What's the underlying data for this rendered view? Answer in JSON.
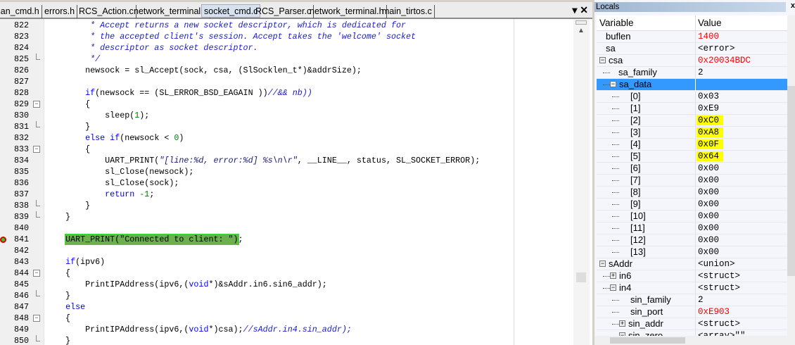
{
  "tabs": [
    "wlan_cmd.h",
    "errors.h",
    "RCS_Action.c",
    "network_terminal.c",
    "socket_cmd.c",
    "RCS_Parser.c",
    "network_terminal.h",
    "main_tirtos.c"
  ],
  "active_tab": "socket_cmd.c",
  "tab_controls": "▾ ✕",
  "code": [
    {
      "n": "822",
      "t": [
        [
          "cm",
          "         * Accept returns a new socket descriptor, which is dedicated for"
        ]
      ]
    },
    {
      "n": "823",
      "t": [
        [
          "cm",
          "         * the accepted client's session. Accept takes the 'welcome' socket"
        ]
      ]
    },
    {
      "n": "824",
      "t": [
        [
          "cm",
          "         * descriptor as socket descriptor."
        ]
      ]
    },
    {
      "n": "825",
      "f": "end",
      "t": [
        [
          "cm",
          "         */"
        ]
      ]
    },
    {
      "n": "826",
      "t": [
        [
          "",
          "        newsock = sl_Accept(sock, csa, (SlSocklen_t*)&addrSize);"
        ]
      ]
    },
    {
      "n": "827",
      "t": []
    },
    {
      "n": "828",
      "t": [
        [
          "",
          "        "
        ],
        [
          "kw",
          "if"
        ],
        [
          "",
          "(newsock == (SL_ERROR_BSD_EAGAIN ))"
        ],
        [
          "cm",
          "//&& nb))"
        ]
      ]
    },
    {
      "n": "829",
      "f": "open",
      "t": [
        [
          "",
          "        {"
        ]
      ]
    },
    {
      "n": "830",
      "t": [
        [
          "",
          "            sleep("
        ],
        [
          "nm",
          "1"
        ],
        [
          "",
          ");"
        ]
      ]
    },
    {
      "n": "831",
      "f": "end",
      "t": [
        [
          "",
          "        }"
        ]
      ]
    },
    {
      "n": "832",
      "t": [
        [
          "",
          "        "
        ],
        [
          "kw",
          "else if"
        ],
        [
          "",
          "(newsock < "
        ],
        [
          "nm",
          "0"
        ],
        [
          "",
          ")"
        ]
      ]
    },
    {
      "n": "833",
      "f": "open",
      "t": [
        [
          "",
          "        {"
        ]
      ]
    },
    {
      "n": "834",
      "t": [
        [
          "",
          "            UART_PRINT("
        ],
        [
          "str",
          "\"[line:%d, error:%d] %s\\n\\r\""
        ],
        [
          "",
          ", __LINE__, status, SL_SOCKET_ERROR);"
        ]
      ]
    },
    {
      "n": "835",
      "t": [
        [
          "",
          "            sl_Close(newsock);"
        ]
      ]
    },
    {
      "n": "836",
      "t": [
        [
          "",
          "            sl_Close(sock);"
        ]
      ]
    },
    {
      "n": "837",
      "t": [
        [
          "",
          "            "
        ],
        [
          "kw",
          "return"
        ],
        [
          "nm",
          " -1"
        ],
        [
          "",
          ";"
        ]
      ]
    },
    {
      "n": "838",
      "f": "end",
      "t": [
        [
          "",
          "        }"
        ]
      ]
    },
    {
      "n": "839",
      "f": "end",
      "t": [
        [
          "",
          "    }"
        ]
      ]
    },
    {
      "n": "840",
      "t": []
    },
    {
      "n": "841",
      "cur": true,
      "t": [
        [
          "",
          "    "
        ],
        [
          "hl",
          "UART_PRINT(\"Connected to client: \")"
        ],
        [
          "",
          ";"
        ]
      ]
    },
    {
      "n": "842",
      "t": []
    },
    {
      "n": "843",
      "t": [
        [
          "",
          "    "
        ],
        [
          "kw",
          "if"
        ],
        [
          "",
          "(ipv6)"
        ]
      ]
    },
    {
      "n": "844",
      "f": "open",
      "t": [
        [
          "",
          "    {"
        ]
      ]
    },
    {
      "n": "845",
      "t": [
        [
          "",
          "        PrintIPAddress(ipv6,("
        ],
        [
          "kw",
          "void"
        ],
        [
          "",
          "*)&sAddr.in6.sin6_addr);"
        ]
      ]
    },
    {
      "n": "846",
      "f": "end",
      "t": [
        [
          "",
          "    }"
        ]
      ]
    },
    {
      "n": "847",
      "t": [
        [
          "",
          "    "
        ],
        [
          "kw",
          "else"
        ]
      ]
    },
    {
      "n": "848",
      "f": "open",
      "t": [
        [
          "",
          "    {"
        ]
      ]
    },
    {
      "n": "849",
      "t": [
        [
          "",
          "        PrintIPAddress(ipv6,("
        ],
        [
          "kw",
          "void"
        ],
        [
          "",
          "*)csa);"
        ],
        [
          "cm",
          "//sAddr.in4.sin_addr);"
        ]
      ]
    },
    {
      "n": "850",
      "f": "end",
      "t": [
        [
          "",
          "    }"
        ]
      ]
    }
  ],
  "locals": {
    "title": "Locals",
    "col_variable": "Variable",
    "col_value": "Value",
    "rows": [
      {
        "name": "buflen",
        "value": "1400",
        "changed": true,
        "d": 0
      },
      {
        "name": "sa",
        "value": "<error>",
        "d": 0
      },
      {
        "name": "csa",
        "value": "0x20034BDC",
        "changed": true,
        "d": 0,
        "exp": "-"
      },
      {
        "name": "sa_family",
        "value": "2",
        "d": 1
      },
      {
        "name": "sa_data",
        "value": "",
        "d": 1,
        "exp": "-",
        "sel": true
      },
      {
        "name": "[0]",
        "value": "0x03",
        "d": 2
      },
      {
        "name": "[1]",
        "value": "0xE9",
        "d": 2
      },
      {
        "name": "[2]",
        "value": "0xC0",
        "d": 2,
        "yellow": true
      },
      {
        "name": "[3]",
        "value": "0xA8",
        "d": 2,
        "yellow": true
      },
      {
        "name": "[4]",
        "value": "0x0F",
        "d": 2,
        "yellow": true
      },
      {
        "name": "[5]",
        "value": "0x64",
        "d": 2,
        "yellow": true
      },
      {
        "name": "[6]",
        "value": "0x00",
        "d": 2
      },
      {
        "name": "[7]",
        "value": "0x00",
        "d": 2
      },
      {
        "name": "[8]",
        "value": "0x00",
        "d": 2
      },
      {
        "name": "[9]",
        "value": "0x00",
        "d": 2
      },
      {
        "name": "[10]",
        "value": "0x00",
        "d": 2
      },
      {
        "name": "[11]",
        "value": "0x00",
        "d": 2
      },
      {
        "name": "[12]",
        "value": "0x00",
        "d": 2
      },
      {
        "name": "[13]",
        "value": "0x00",
        "d": 2
      },
      {
        "name": "sAddr",
        "value": "<union>",
        "d": 0,
        "exp": "-"
      },
      {
        "name": "in6",
        "value": "<struct>",
        "d": 1,
        "exp": "+"
      },
      {
        "name": "in4",
        "value": "<struct>",
        "d": 1,
        "exp": "-"
      },
      {
        "name": "sin_family",
        "value": "2",
        "d": 2
      },
      {
        "name": "sin_port",
        "value": "0xE903",
        "changed": true,
        "d": 2
      },
      {
        "name": "sin_addr",
        "value": "<struct>",
        "d": 2,
        "exp": "+"
      },
      {
        "name": "sin_zero",
        "value": "<array>\"\"",
        "d": 2,
        "exp": "-"
      }
    ]
  },
  "colors": {
    "changed": "#ff0000",
    "highlight": "#ffff00",
    "selection": "#3399ff",
    "current_line": "#6ab04c"
  }
}
